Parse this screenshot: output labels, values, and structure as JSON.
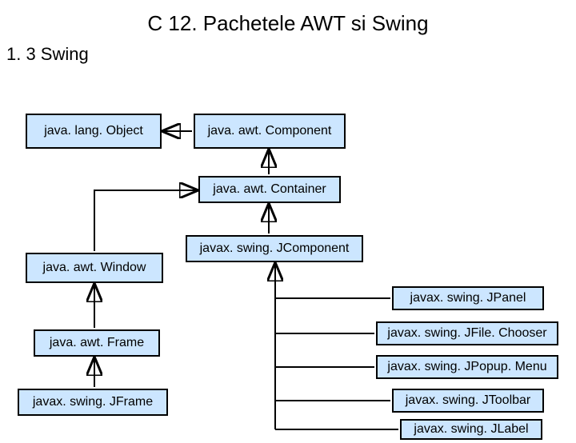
{
  "title": "C 12. Pachetele AWT si Swing",
  "subtitle": "1. 3 Swing",
  "nodes": {
    "object": "java. lang. Object",
    "component": "java. awt. Component",
    "container": "java. awt. Container",
    "jcomponent": "javax. swing. JComponent",
    "window": "java. awt. Window",
    "frame": "java. awt. Frame",
    "jframe": "javax. swing. JFrame",
    "jpanel": "javax. swing. JPanel",
    "jfilechooser": "javax. swing. JFile. Chooser",
    "jpopupmenu": "javax. swing. JPopup. Menu",
    "jtoolbar": "javax. swing. JToolbar",
    "jlabel": "javax. swing. JLabel"
  }
}
